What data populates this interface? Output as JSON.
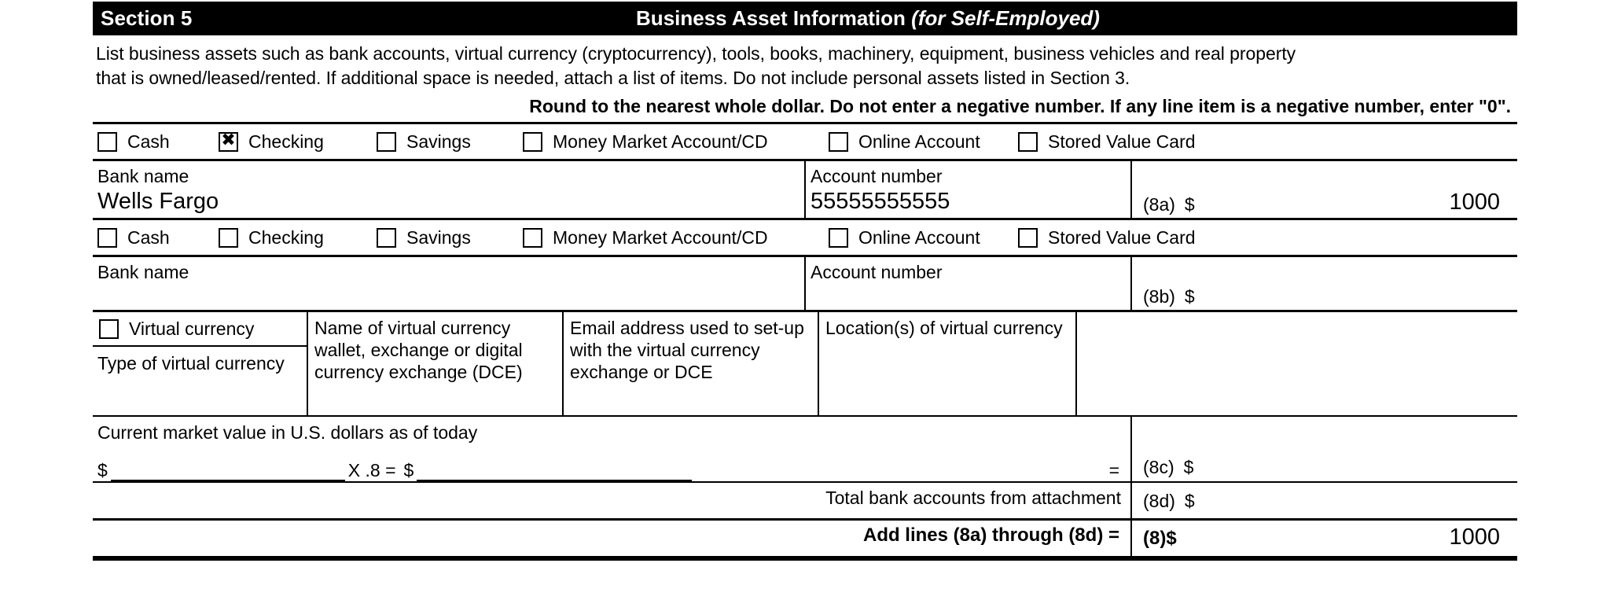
{
  "section": {
    "label": "Section 5",
    "title_main": "Business Asset Information ",
    "title_italic": "(for Self-Employed)"
  },
  "instructions": {
    "line1": "List business assets such as bank accounts, virtual currency (cryptocurrency), tools, books, machinery, equipment, business vehicles and real property",
    "line2": "that is owned/leased/rented. If additional space is needed, attach a list of items. Do not include personal assets listed in Section 3.",
    "rounding_note": "Round to the nearest whole dollar. Do not enter a negative number. If any line item is a negative number, enter \"0\"."
  },
  "account_types": {
    "cash": "Cash",
    "checking": "Checking",
    "savings": "Savings",
    "money_market": "Money Market Account/CD",
    "online": "Online Account",
    "stored_value": "Stored Value Card"
  },
  "checkmark_glyph": "✖",
  "rows": {
    "row_8a": {
      "checked": "checking",
      "bank_name_label": "Bank name",
      "bank_name_value": "Wells Fargo",
      "account_number_label": "Account number",
      "account_number_value": "55555555555",
      "line_tag": "(8a)",
      "dollar": "$",
      "amount": "1000"
    },
    "row_8b": {
      "checked": "",
      "bank_name_label": "Bank name",
      "bank_name_value": "",
      "account_number_label": "Account number",
      "account_number_value": "",
      "line_tag": "(8b)",
      "dollar": "$",
      "amount": ""
    }
  },
  "virtual_currency": {
    "checkbox_label": "Virtual currency",
    "type_label": "Type of virtual currency",
    "name_label": "Name of virtual currency wallet, exchange or digital currency exchange (DCE)",
    "email_label": "Email address used to set-up with the virtual currency exchange or DCE",
    "location_label": "Location(s) of virtual currency",
    "type_value": "",
    "name_value": "",
    "email_value": "",
    "location_value": ""
  },
  "market_value": {
    "label": "Current market value in U.S. dollars as of today",
    "dollar": "$",
    "value1": "",
    "multiplier": "X .8 =",
    "dollar2": "$",
    "value2": "",
    "equals": "=",
    "line_tag": "(8c)",
    "amount": ""
  },
  "attachment": {
    "label": "Total bank accounts from attachment",
    "line_tag": "(8d)",
    "dollar": "$",
    "amount": ""
  },
  "total": {
    "label": "Add lines (8a) through (8d) =",
    "line_tag": "(8)",
    "dollar": "$",
    "amount": "1000"
  }
}
